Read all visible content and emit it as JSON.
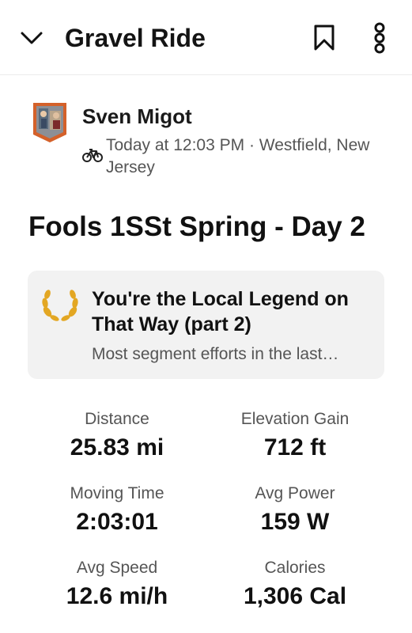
{
  "header": {
    "title": "Gravel Ride",
    "icons": {
      "back": "chevron-down-icon",
      "save": "bookmark-icon",
      "more": "more-vertical-icon"
    }
  },
  "athlete": {
    "name": "Sven Migot",
    "sport_icon": "bike-icon",
    "meta": "Today at 12:03 PM · Westfield, New Jersey"
  },
  "activity": {
    "title": "Fools 1SSt Spring - Day 2"
  },
  "achievement": {
    "icon": "laurel-icon",
    "title": "You're the Local Legend on That Way (part 2)",
    "subtitle": "Most segment efforts in the last…"
  },
  "stats": [
    {
      "label": "Distance",
      "value": "25.83 mi"
    },
    {
      "label": "Elevation Gain",
      "value": "712 ft"
    },
    {
      "label": "Moving Time",
      "value": "2:03:01"
    },
    {
      "label": "Avg Power",
      "value": "159 W"
    },
    {
      "label": "Avg Speed",
      "value": "12.6 mi/h"
    },
    {
      "label": "Calories",
      "value": "1,306 Cal"
    }
  ],
  "colors": {
    "legend_gold": "#e3a723",
    "avatar_border": "#d4612a",
    "card_bg": "#f2f2f2"
  }
}
